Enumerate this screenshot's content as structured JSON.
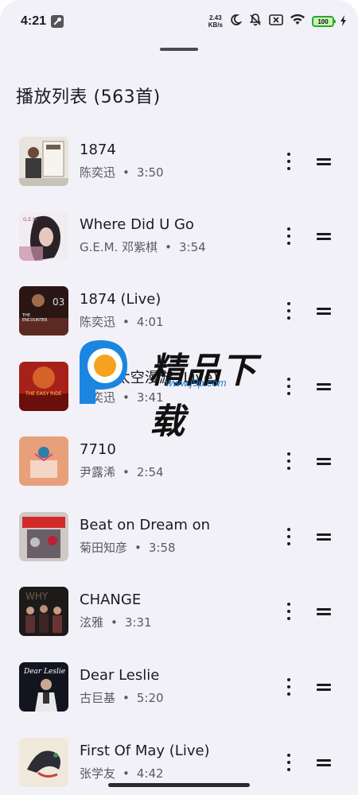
{
  "status_bar": {
    "time": "4:21",
    "speed_value": "2.43",
    "speed_unit": "KB/s",
    "battery": "100"
  },
  "playlist": {
    "title": "播放列表 (563首)"
  },
  "tracks": [
    {
      "title": "1874",
      "artist": "陈奕迅",
      "duration": "3:50"
    },
    {
      "title": "Where Did U Go",
      "artist": "G.E.M. 邓紫棋",
      "duration": "3:54"
    },
    {
      "title": "1874 (Live)",
      "artist": "陈奕迅",
      "duration": "4:01"
    },
    {
      "title": "2001太空漫游 (Live)",
      "artist": "陈奕迅",
      "duration": "3:41"
    },
    {
      "title": "7710",
      "artist": "尹露浠",
      "duration": "2:54"
    },
    {
      "title": "Beat on Dream on",
      "artist": "菊田知彦",
      "duration": "3:58"
    },
    {
      "title": "CHANGE",
      "artist": "泫雅",
      "duration": "3:31"
    },
    {
      "title": "Dear Leslie",
      "artist": "古巨基",
      "duration": "5:20"
    },
    {
      "title": "First Of May (Live)",
      "artist": "张学友",
      "duration": "4:42"
    }
  ],
  "separator": "•",
  "watermark": {
    "text": "精品下载",
    "url": "www.j9p.com"
  },
  "icons": {
    "more": "more-vert-icon",
    "drag": "drag-handle-icon"
  },
  "colors": {
    "background": "#f3f1f8",
    "text_primary": "#1b1b1f",
    "text_secondary": "#5a5a60",
    "battery": "#2aa82a"
  }
}
